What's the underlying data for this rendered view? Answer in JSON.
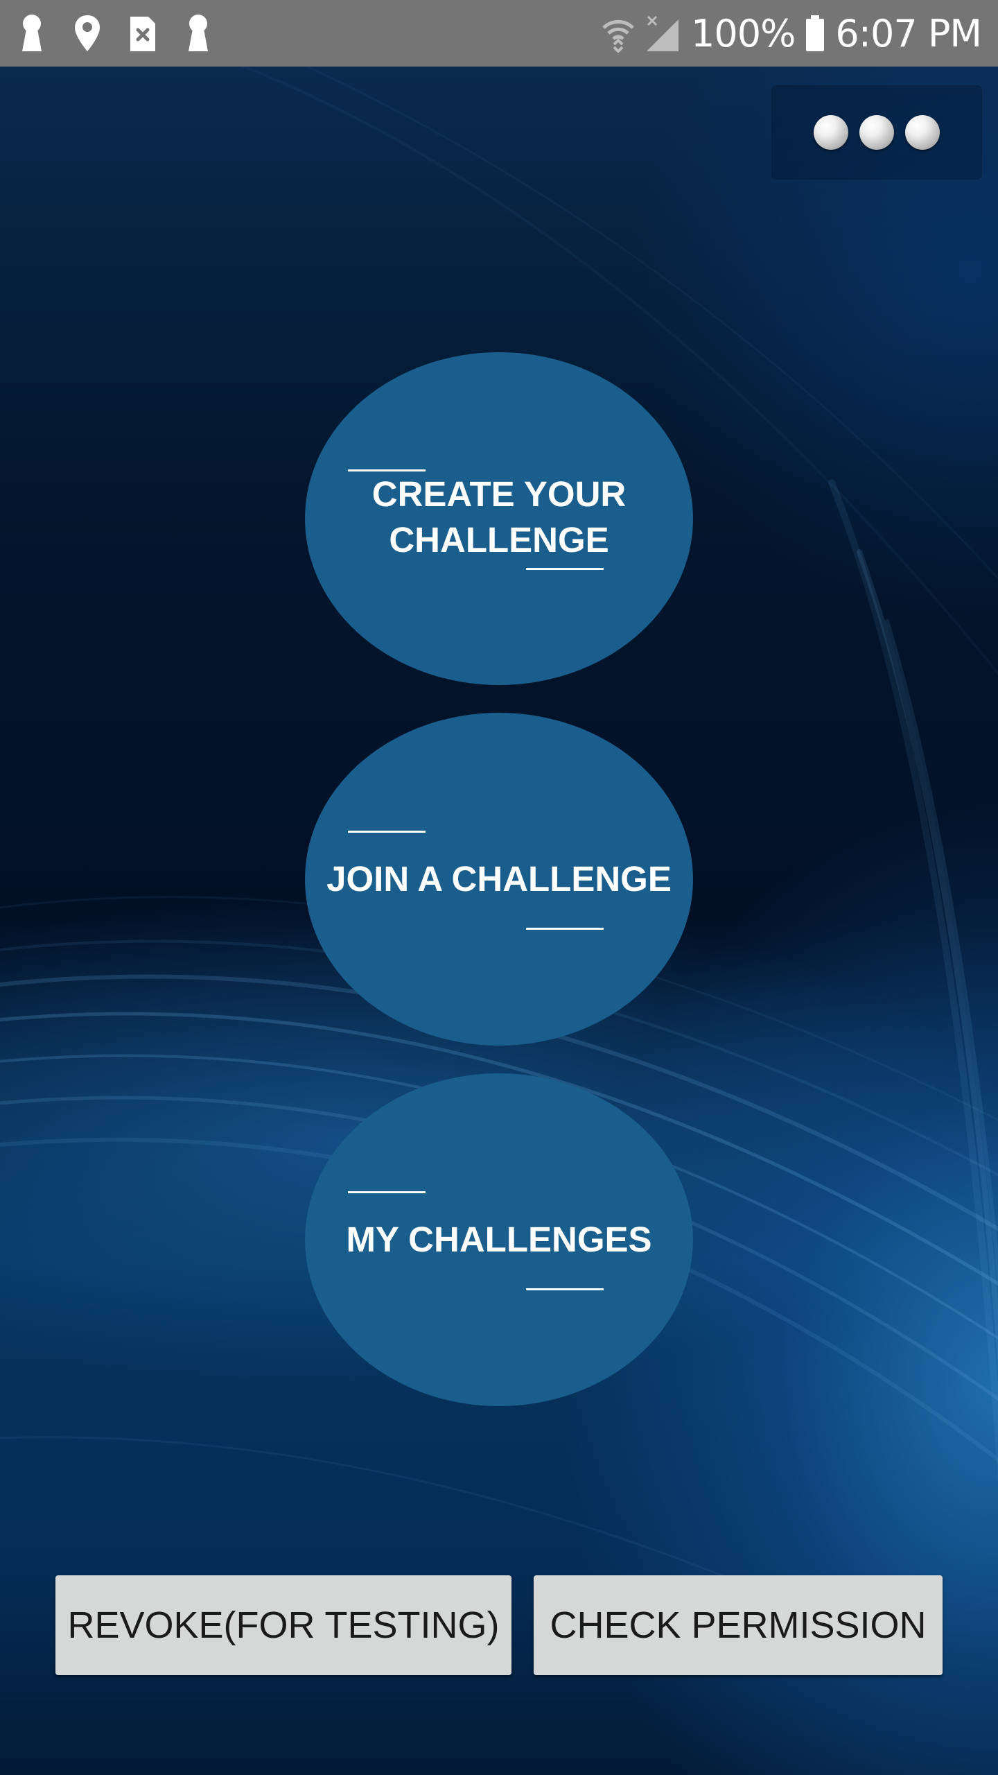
{
  "status_bar": {
    "left_icons": [
      "keyhole-icon",
      "location-pin-icon",
      "sim-card-error-icon",
      "keyhole-icon"
    ],
    "right_icons": [
      "wifi-icon",
      "cell-signal-icon",
      "battery-icon"
    ],
    "battery_percent": "100%",
    "time": "6:07 PM"
  },
  "overflow_menu": {
    "icon": "three-dots-icon"
  },
  "main_buttons": {
    "create": "CREATE YOUR\nCHALLENGE",
    "join": "JOIN A CHALLENGE",
    "mine": "MY CHALLENGES"
  },
  "bottom_buttons": {
    "revoke": "REVOKE(FOR TESTING)",
    "check_permission": "CHECK PERMISSION"
  },
  "colors": {
    "status_bar": "#757575",
    "circle_button": "#1a5e8d",
    "gray_button": "#d6d7d7",
    "button_text": "#1a1a1a"
  }
}
